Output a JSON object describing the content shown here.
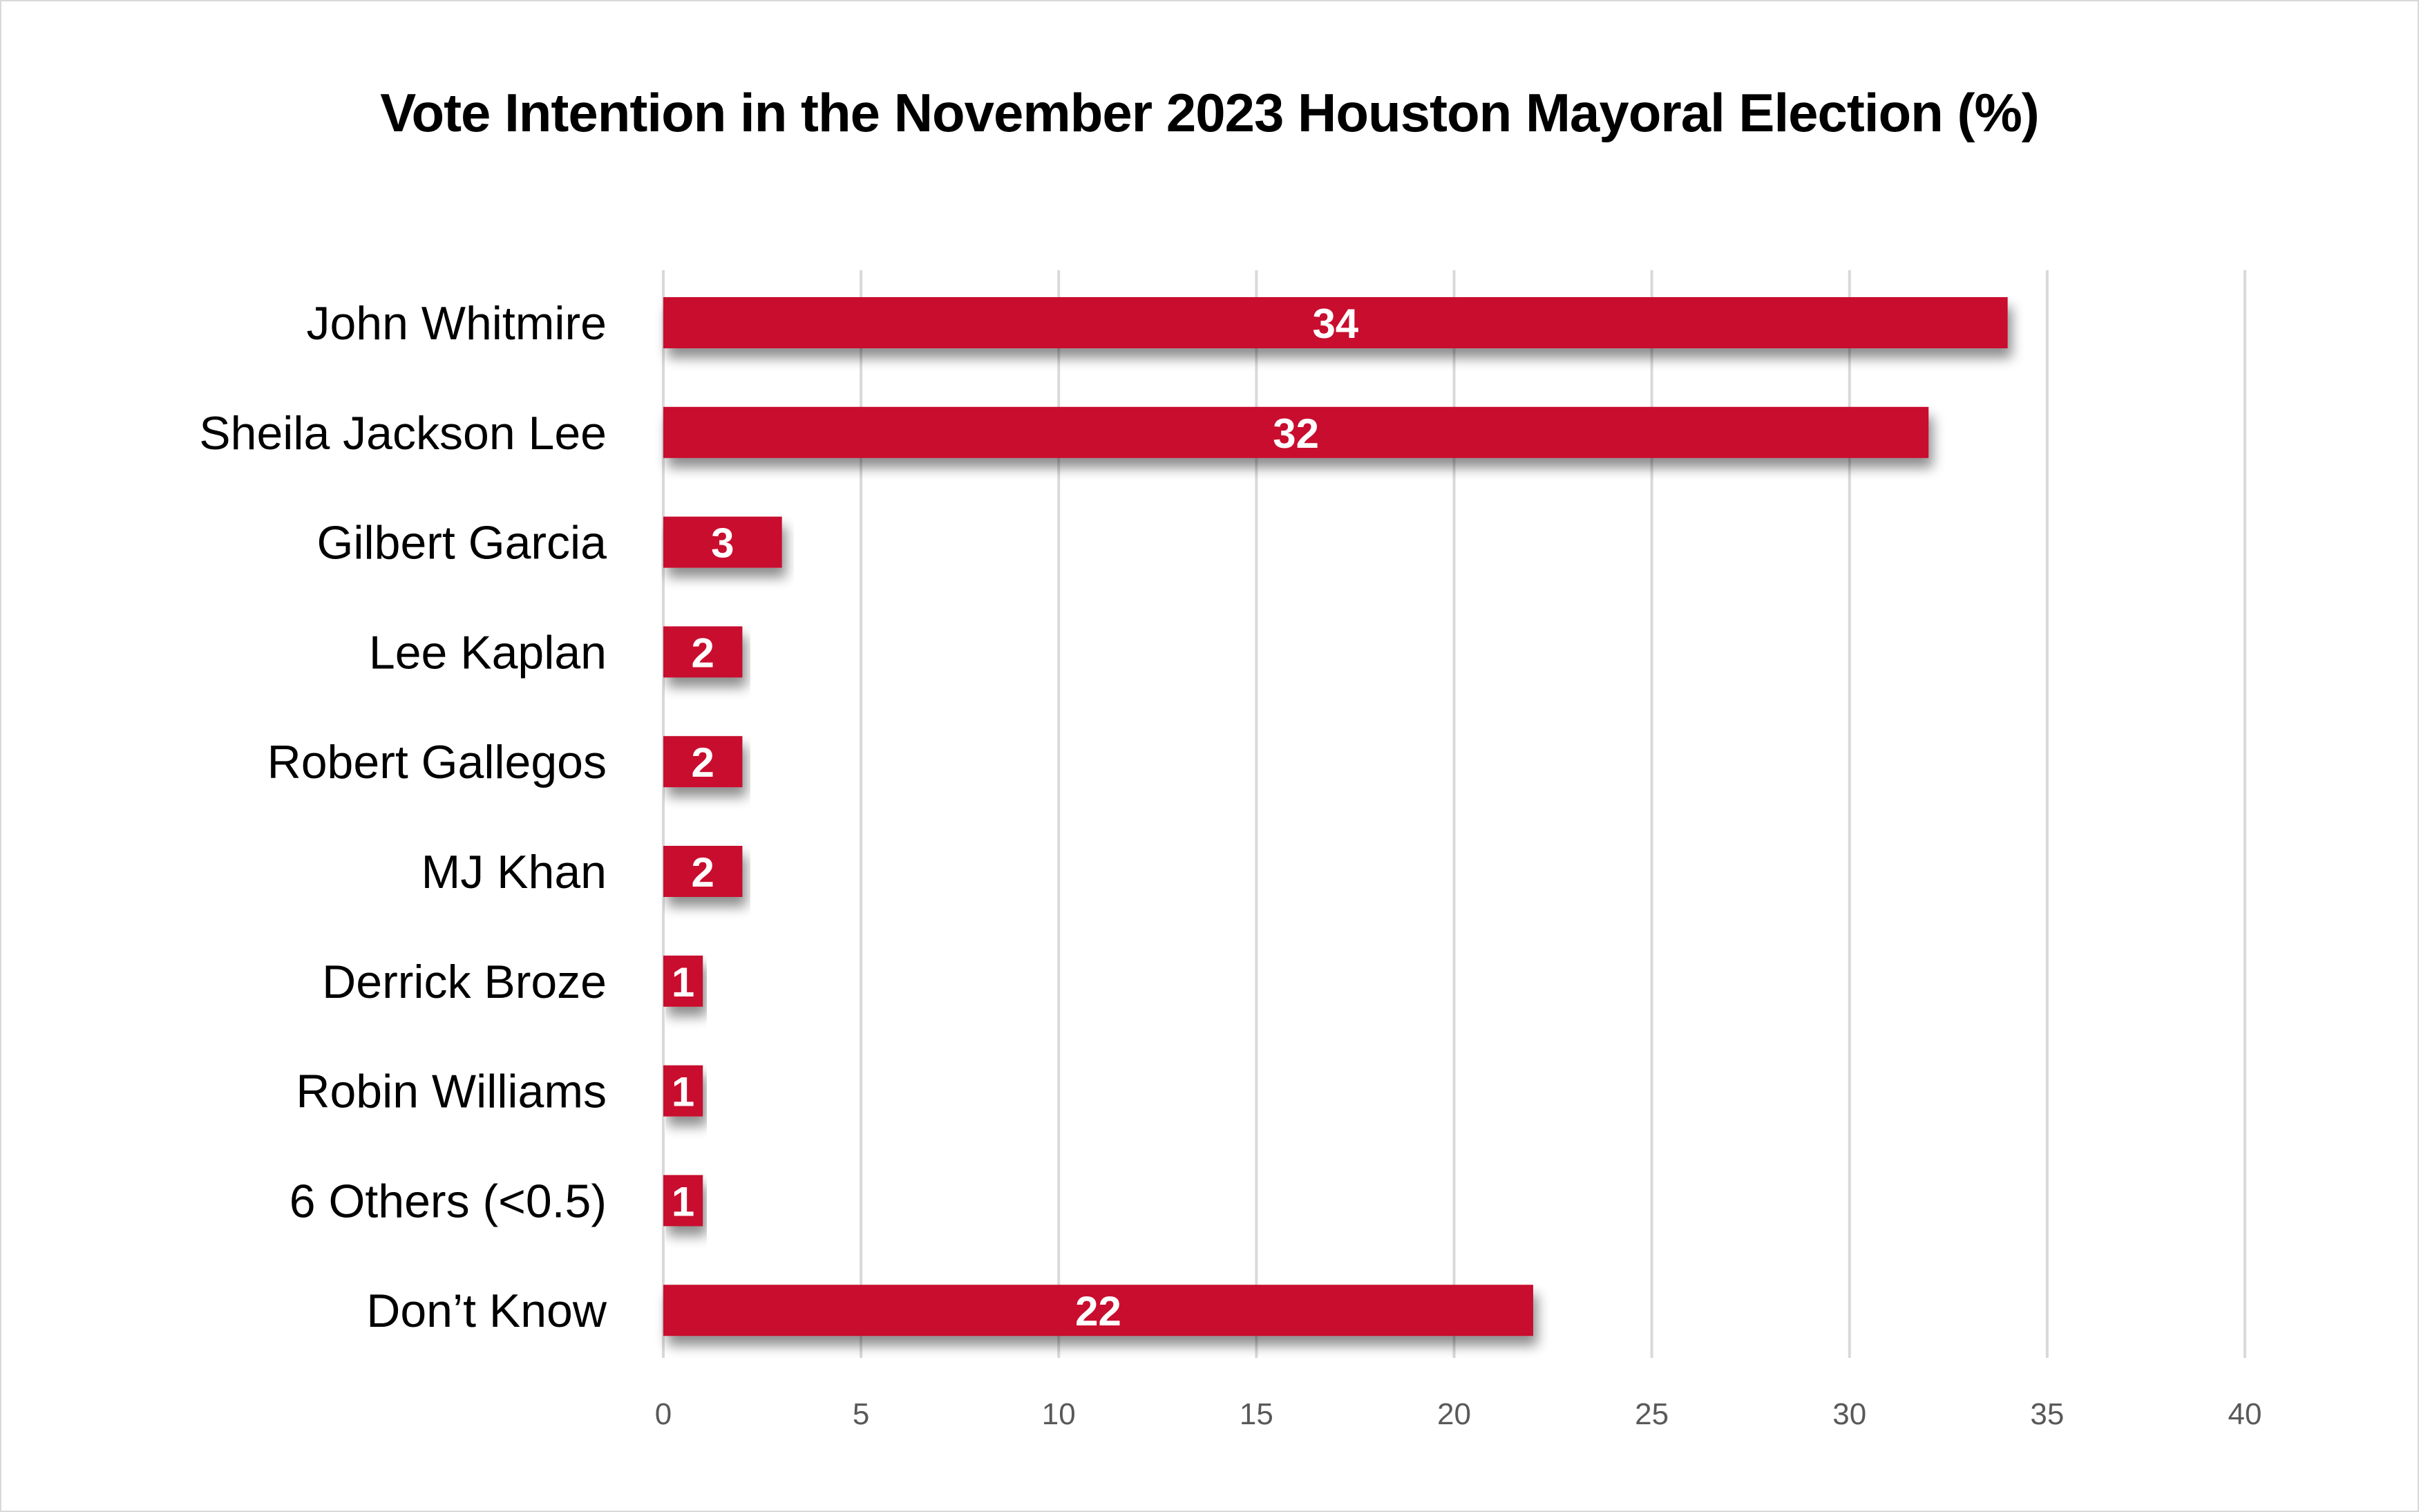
{
  "chart_data": {
    "type": "bar",
    "orientation": "horizontal",
    "title": "Vote Intention in the November 2023 Houston Mayoral Election (%)",
    "categories": [
      "John Whitmire",
      "Sheila Jackson Lee",
      "Gilbert Garcia",
      "Lee Kaplan",
      "Robert Gallegos",
      "MJ Khan",
      "Derrick Broze",
      "Robin Williams",
      "6 Others (<0.5)",
      "Don’t Know"
    ],
    "values": [
      34,
      32,
      3,
      2,
      2,
      2,
      1,
      1,
      1,
      22
    ],
    "data_labels": [
      "34",
      "32",
      "3",
      "2",
      "2",
      "2",
      "1",
      "1",
      "1",
      "22"
    ],
    "xlabel": "",
    "ylabel": "",
    "xlim": [
      0,
      40
    ],
    "xticks": [
      0,
      5,
      10,
      15,
      20,
      25,
      30,
      35,
      40
    ],
    "xtick_labels": [
      "0",
      "5",
      "10",
      "15",
      "20",
      "25",
      "30",
      "35",
      "40"
    ],
    "grid": "vertical",
    "legend": "none",
    "bar_color": "#C8102E",
    "gridline_color": "#D9D9D9"
  }
}
